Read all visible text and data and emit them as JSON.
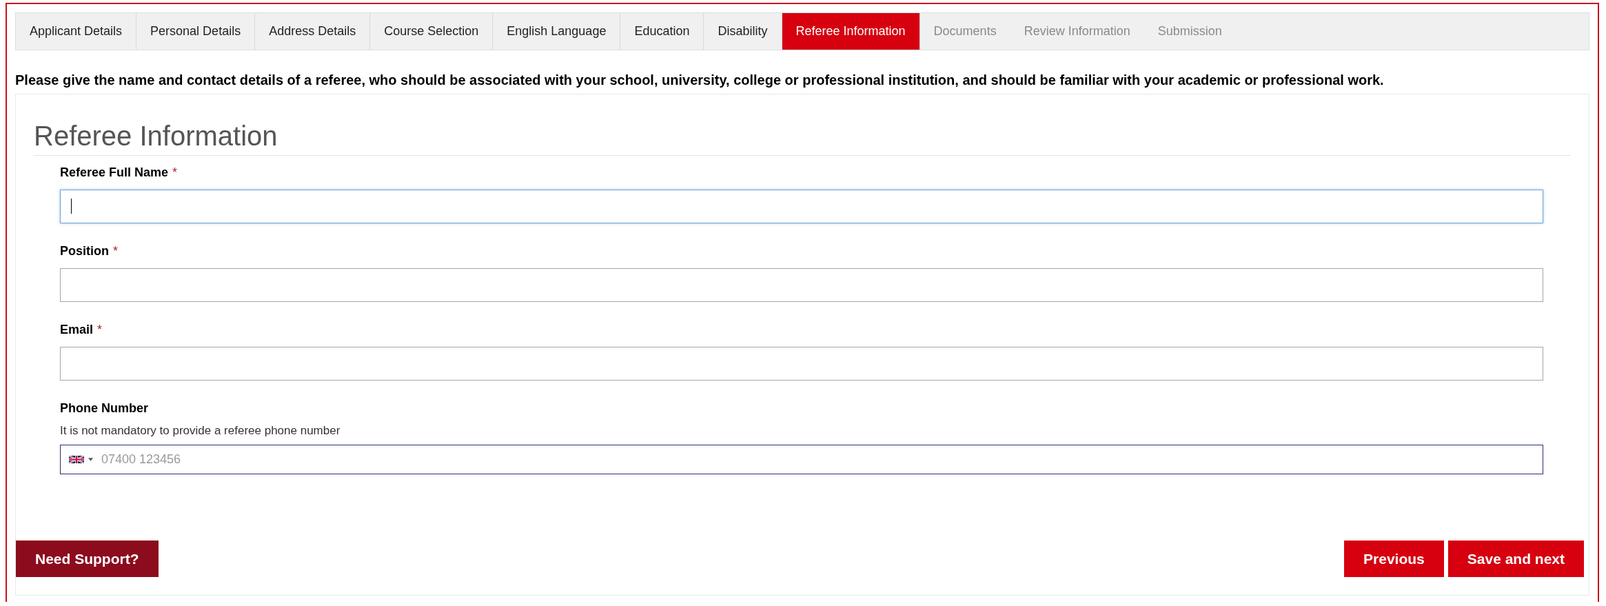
{
  "tabs": [
    {
      "label": "Applicant Details",
      "selected": false,
      "disabled": false
    },
    {
      "label": "Personal Details",
      "selected": false,
      "disabled": false
    },
    {
      "label": "Address Details",
      "selected": false,
      "disabled": false
    },
    {
      "label": "Course Selection",
      "selected": false,
      "disabled": false
    },
    {
      "label": "English Language",
      "selected": false,
      "disabled": false
    },
    {
      "label": "Education",
      "selected": false,
      "disabled": false
    },
    {
      "label": "Disability",
      "selected": false,
      "disabled": false
    },
    {
      "label": "Referee Information",
      "selected": true,
      "disabled": false
    },
    {
      "label": "Documents",
      "selected": false,
      "disabled": true
    },
    {
      "label": "Review Information",
      "selected": false,
      "disabled": true
    },
    {
      "label": "Submission",
      "selected": false,
      "disabled": true
    }
  ],
  "instruction": "Please give the name and contact details of a referee, who should be associated with your school, university, college or professional institution, and should be familiar with your academic or professional work.",
  "section_title": "Referee Information",
  "fields": [
    {
      "kind": "text",
      "label": "Referee Full Name",
      "required_mark": "*",
      "focused": true
    },
    {
      "kind": "text",
      "label": "Position",
      "required_mark": "*",
      "focused": false
    },
    {
      "kind": "text",
      "label": "Email",
      "required_mark": "*",
      "focused": false
    },
    {
      "kind": "phone",
      "label": "Phone Number",
      "hint": "It is not mandatory to provide a referee phone number",
      "placeholder": "07400 123456",
      "focused": false
    }
  ],
  "support_button": "Need Support?",
  "nav_buttons": [
    "Previous",
    "Save and next"
  ]
}
